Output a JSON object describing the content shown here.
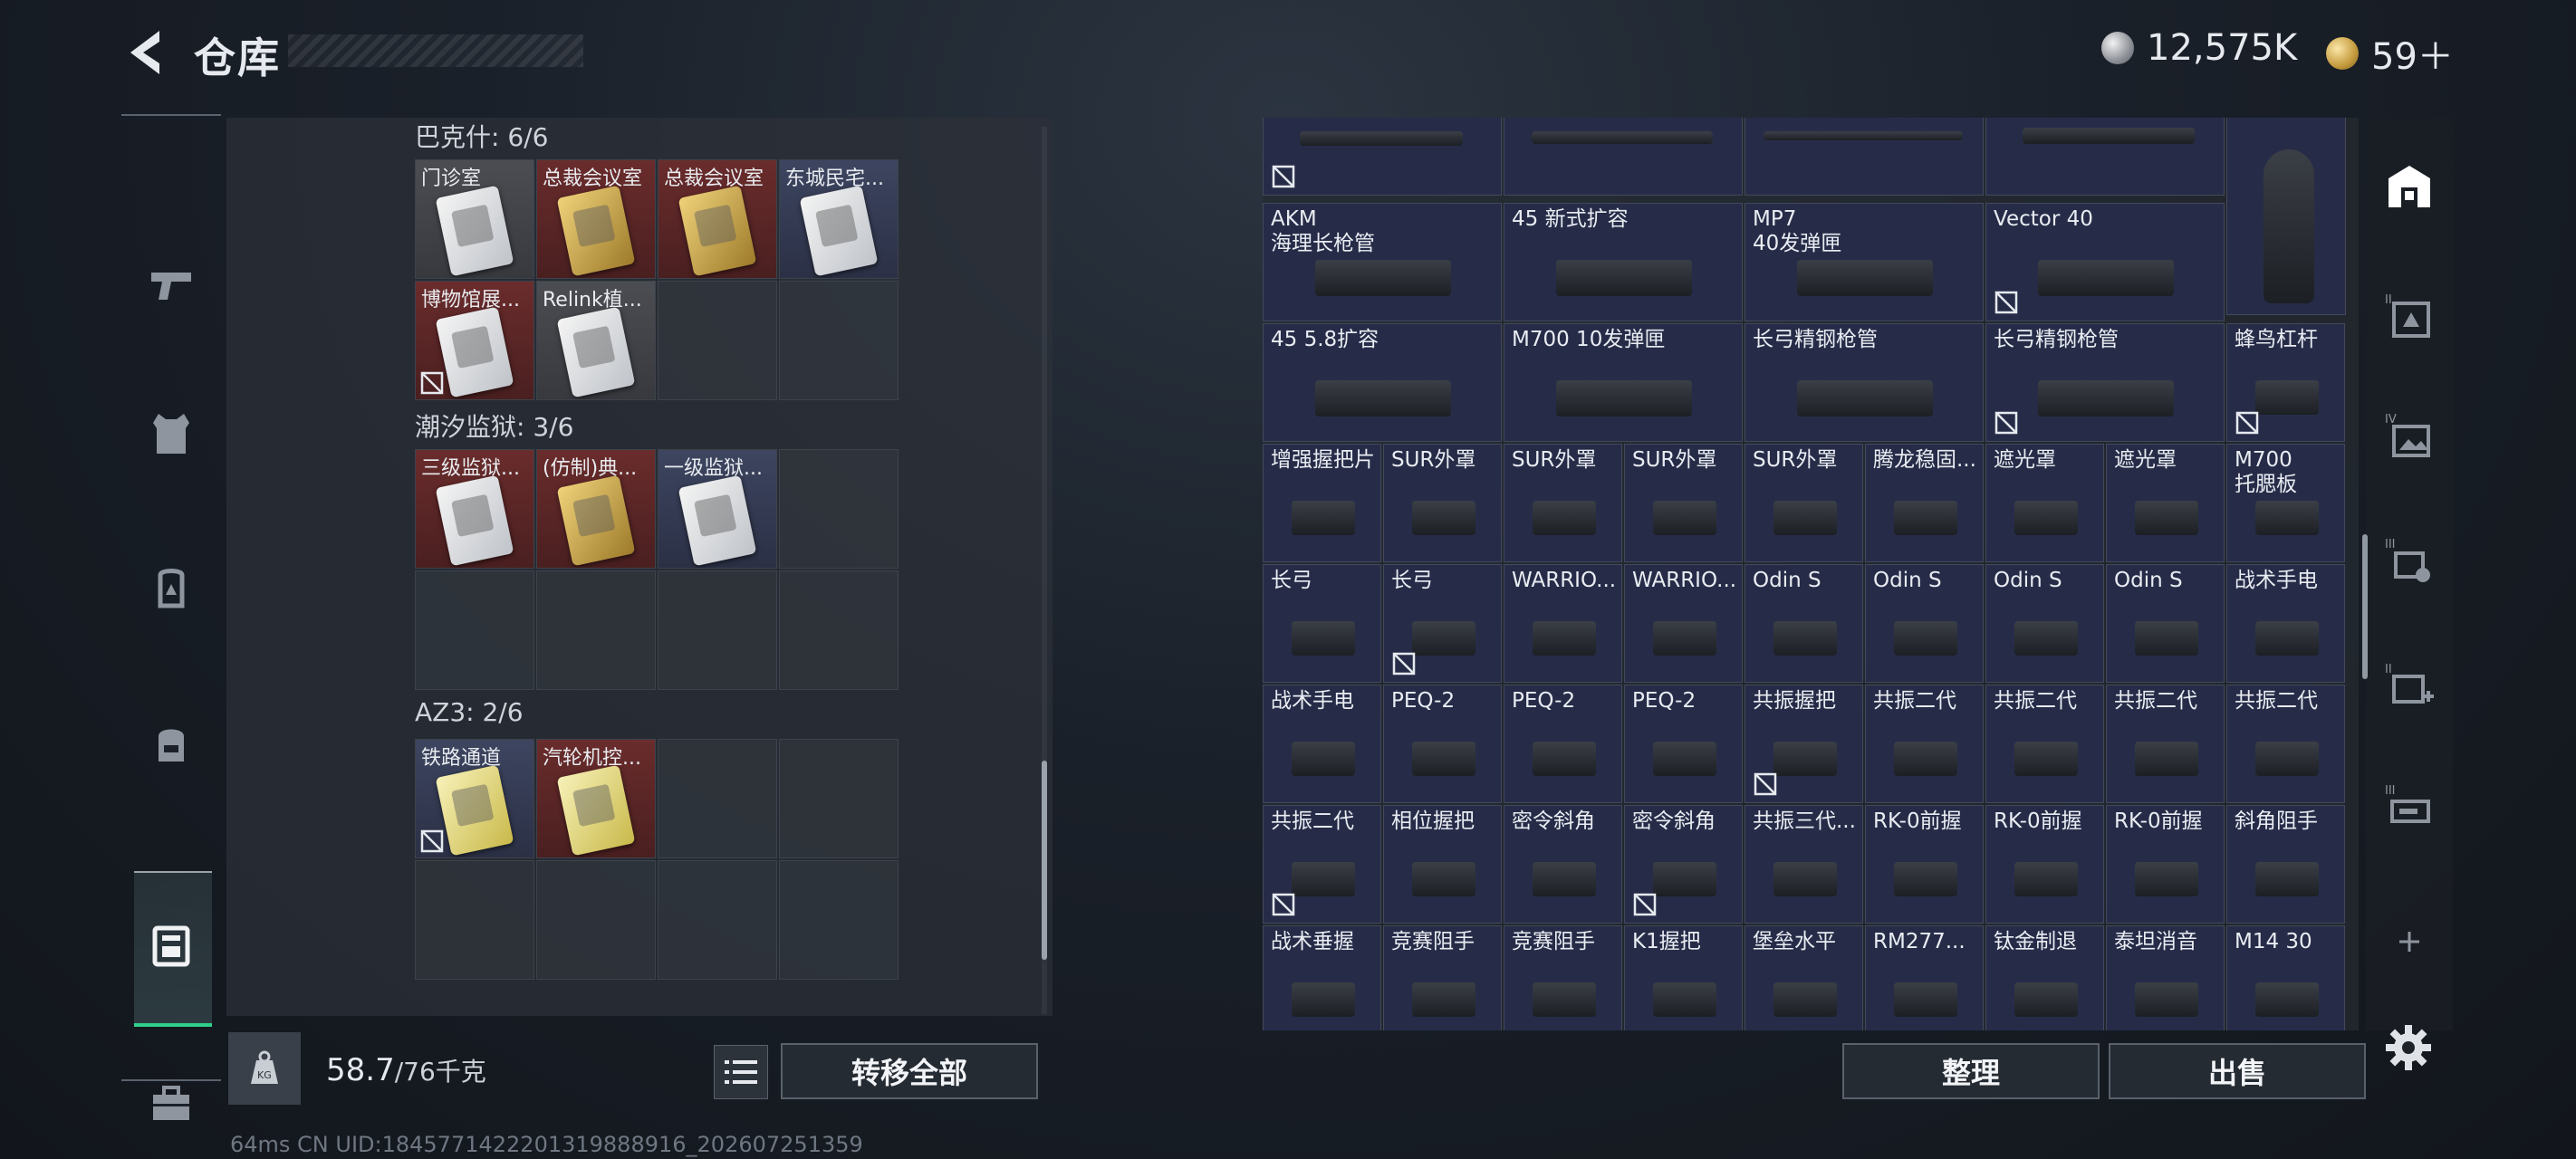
{
  "header": {
    "title": "仓库",
    "currency1": "12,575K",
    "currency2": "59＋"
  },
  "left_panel": {
    "sections": [
      {
        "label": "巴克什: 6/6",
        "slots": [
          {
            "label": "门诊室",
            "bg": "gray",
            "card": "white",
            "nosale": false
          },
          {
            "label": "总裁会议室",
            "bg": "red",
            "card": "gold",
            "nosale": false
          },
          {
            "label": "总裁会议室",
            "bg": "red",
            "card": "gold",
            "nosale": false
          },
          {
            "label": "东城民宅...",
            "bg": "blue",
            "card": "white",
            "nosale": false
          },
          {
            "label": "博物馆展...",
            "bg": "red",
            "card": "white",
            "nosale": true
          },
          {
            "label": "Relink植...",
            "bg": "gray",
            "card": "white",
            "nosale": false
          }
        ]
      },
      {
        "label": "潮汐监狱: 3/6",
        "slots": [
          {
            "label": "三级监狱...",
            "bg": "red",
            "card": "red",
            "nosale": false
          },
          {
            "label": "(仿制)典...",
            "bg": "red",
            "card": "gold",
            "nosale": false
          },
          {
            "label": "一级监狱...",
            "bg": "blue",
            "card": "white",
            "nosale": false
          }
        ]
      },
      {
        "label": "AZ3: 2/6",
        "slots": [
          {
            "label": "铁路通道",
            "bg": "blue",
            "card": "yellow",
            "nosale": true
          },
          {
            "label": "汽轮机控...",
            "bg": "red",
            "card": "yellow",
            "nosale": false
          }
        ]
      }
    ],
    "weight_value": "58.7",
    "weight_unit": "/76千克",
    "transfer_all": "转移全部"
  },
  "items": [
    {
      "label": "AKM\n海理长枪管",
      "nosale": false
    },
    {
      "label": "45 新式扩容",
      "nosale": false
    },
    {
      "label": "MP7\n40发弹匣",
      "nosale": false
    },
    {
      "label": "Vector 40",
      "nosale": true
    },
    {
      "label": "45 5.8扩容",
      "nosale": false
    },
    {
      "label": "M700 10发弹匣",
      "nosale": false
    },
    {
      "label": "长弓精钢枪管",
      "nosale": false
    },
    {
      "label": "长弓精钢枪管",
      "nosale": true
    },
    {
      "label": "蜂鸟杠杆",
      "nosale": true
    },
    {
      "label": "增强握把片",
      "nosale": false
    },
    {
      "label": "SUR外罩",
      "nosale": false
    },
    {
      "label": "SUR外罩",
      "nosale": false
    },
    {
      "label": "SUR外罩",
      "nosale": false
    },
    {
      "label": "SUR外罩",
      "nosale": false
    },
    {
      "label": "腾龙稳固...",
      "nosale": false
    },
    {
      "label": "遮光罩",
      "nosale": false
    },
    {
      "label": "遮光罩",
      "nosale": false
    },
    {
      "label": "M700\n托腮板",
      "nosale": false
    },
    {
      "label": "长弓",
      "nosale": false
    },
    {
      "label": "长弓",
      "nosale": true
    },
    {
      "label": "WARRIO...",
      "nosale": false
    },
    {
      "label": "WARRIO...",
      "nosale": false
    },
    {
      "label": "Odin S",
      "nosale": false
    },
    {
      "label": "Odin S",
      "nosale": false
    },
    {
      "label": "Odin S",
      "nosale": false
    },
    {
      "label": "Odin S",
      "nosale": false
    },
    {
      "label": "战术手电",
      "nosale": false
    },
    {
      "label": "战术手电",
      "nosale": false
    },
    {
      "label": "PEQ-2",
      "nosale": false
    },
    {
      "label": "PEQ-2",
      "nosale": false
    },
    {
      "label": "PEQ-2",
      "nosale": false
    },
    {
      "label": "共振握把",
      "nosale": true
    },
    {
      "label": "共振二代",
      "nosale": false
    },
    {
      "label": "共振二代",
      "nosale": false
    },
    {
      "label": "共振二代",
      "nosale": false
    },
    {
      "label": "共振二代",
      "nosale": false
    },
    {
      "label": "共振二代",
      "nosale": true
    },
    {
      "label": "相位握把",
      "nosale": false
    },
    {
      "label": "密令斜角",
      "nosale": false
    },
    {
      "label": "密令斜角",
      "nosale": true
    },
    {
      "label": "共振三代...",
      "nosale": false
    },
    {
      "label": "RK-0前握",
      "nosale": false
    },
    {
      "label": "RK-0前握",
      "nosale": false
    },
    {
      "label": "RK-0前握",
      "nosale": false
    },
    {
      "label": "斜角阻手",
      "nosale": false
    },
    {
      "label": "战术垂握",
      "nosale": false
    },
    {
      "label": "竞赛阻手",
      "nosale": false
    },
    {
      "label": "竞赛阻手",
      "nosale": false
    },
    {
      "label": "K1握把",
      "nosale": false
    },
    {
      "label": "堡垒水平",
      "nosale": false
    },
    {
      "label": "RM277...",
      "nosale": false
    },
    {
      "label": "钛金制退",
      "nosale": false
    },
    {
      "label": "泰坦消音",
      "nosale": false
    },
    {
      "label": "M14 30",
      "nosale": false
    }
  ],
  "actions": {
    "sort": "整理",
    "sell": "出售"
  },
  "footer": "64ms        CN UID:1845771422201319888916_202607251359",
  "colors": {
    "accent_green": "#2fd08c",
    "slot_blue": "#262c48"
  }
}
